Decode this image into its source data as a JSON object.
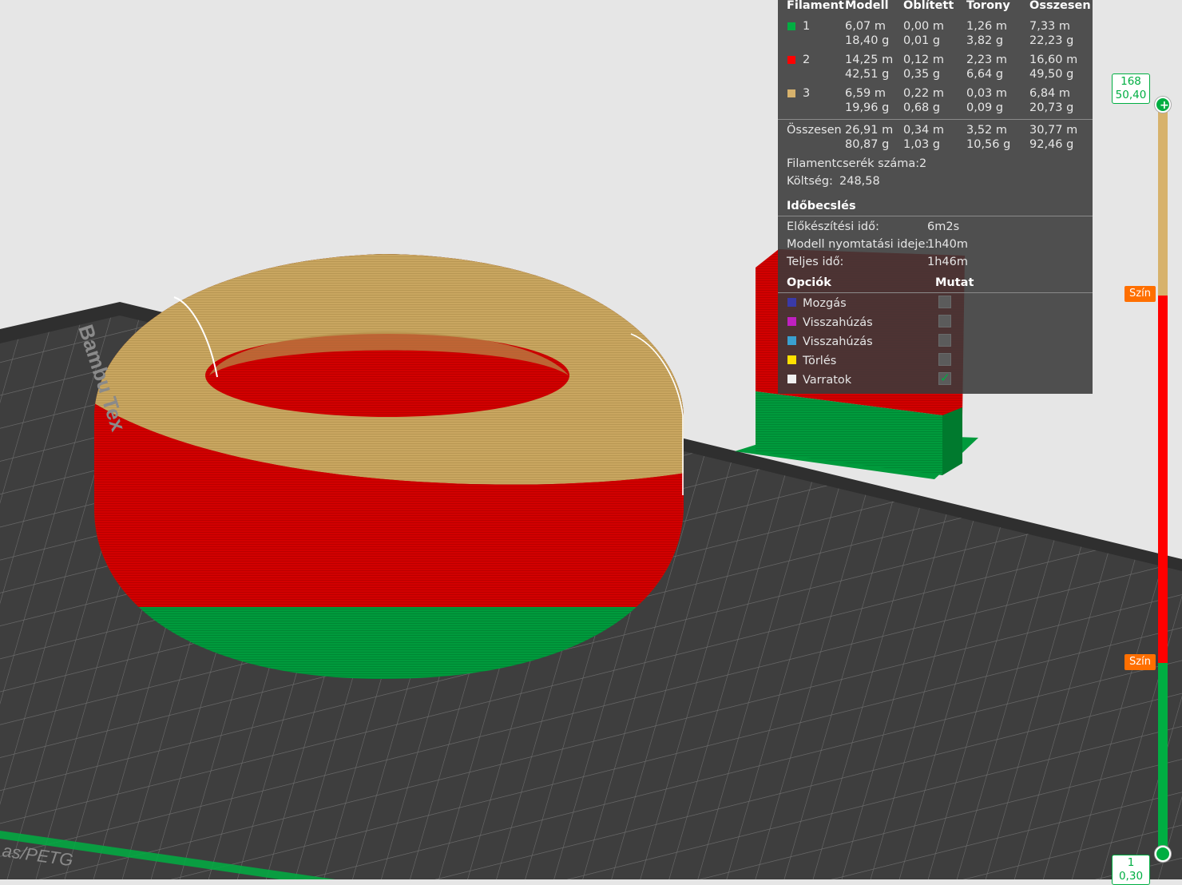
{
  "bed": {
    "brand_text": "Bambu Tex",
    "plate_text": "as/PETG"
  },
  "colors": {
    "filament1": "#009a3c",
    "filament2": "#d20000",
    "filament3": "#c9a660",
    "accent": "#00ae42",
    "tag": "#ff6f00",
    "panel": "#3a3a3a"
  },
  "stats": {
    "headers": [
      "Filament",
      "Modell",
      "Oblített",
      "Torony",
      "Összesen"
    ],
    "rows": [
      {
        "id": "1",
        "color": "#00ae42",
        "model": [
          "6,07 m",
          "18,40 g"
        ],
        "flush": [
          "0,00 m",
          "0,01 g"
        ],
        "tower": [
          "1,26 m",
          "3,82 g"
        ],
        "total": [
          "7,33 m",
          "22,23 g"
        ]
      },
      {
        "id": "2",
        "color": "#ff0000",
        "model": [
          "14,25 m",
          "42,51 g"
        ],
        "flush": [
          "0,12 m",
          "0,35 g"
        ],
        "tower": [
          "2,23 m",
          "6,64 g"
        ],
        "total": [
          "16,60 m",
          "49,50 g"
        ]
      },
      {
        "id": "3",
        "color": "#d7b26c",
        "model": [
          "6,59 m",
          "19,96 g"
        ],
        "flush": [
          "0,22 m",
          "0,68 g"
        ],
        "tower": [
          "0,03 m",
          "0,09 g"
        ],
        "total": [
          "6,84 m",
          "20,73 g"
        ]
      }
    ],
    "sum": {
      "label": "Összesen",
      "model": [
        "26,91 m",
        "80,87 g"
      ],
      "flush": [
        "0,34 m",
        "1,03 g"
      ],
      "tower": [
        "3,52 m",
        "10,56 g"
      ],
      "total": [
        "30,77 m",
        "92,46 g"
      ]
    },
    "changes_label": "Filamentcserék száma:",
    "changes_value": "2",
    "cost_label": "Költség:",
    "cost_value": "248,58",
    "time_title": "Időbecslés",
    "times": [
      {
        "label": "Előkészítési idő:",
        "value": "6m2s"
      },
      {
        "label": "Modell nyomtatási ideje:",
        "value": "1h40m"
      },
      {
        "label": "Teljes idő:",
        "value": "1h46m"
      }
    ],
    "options_title": "Opciók",
    "show_title": "Mutat",
    "options": [
      {
        "label": "Mozgás",
        "color": "#3a3aa8",
        "checked": false
      },
      {
        "label": "Visszahúzás",
        "color": "#c020c0",
        "checked": false
      },
      {
        "label": "Visszahúzás",
        "color": "#3aa0d0",
        "checked": false
      },
      {
        "label": "Törlés",
        "color": "#ffe000",
        "checked": false
      },
      {
        "label": "Varratok",
        "color": "#f0f0f0",
        "checked": true
      }
    ]
  },
  "slider": {
    "top_layer": "168",
    "top_height": "50,40",
    "bottom_layer": "1",
    "bottom_height": "0,30",
    "tag_label": "Szín"
  }
}
